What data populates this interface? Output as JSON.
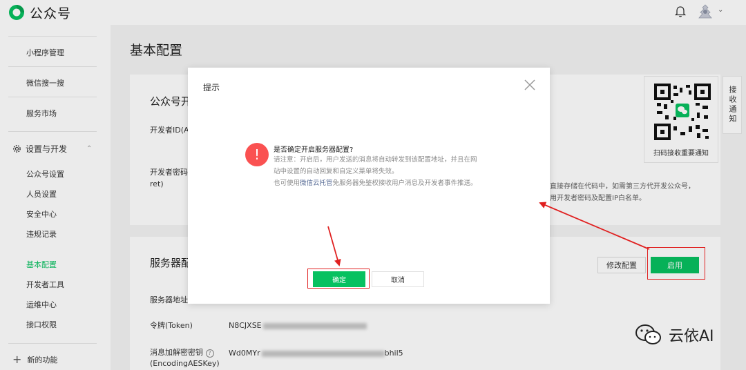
{
  "app": {
    "brand": "公众号"
  },
  "topbar": {
    "bell_icon": "bell-icon",
    "avatar_icon": "avatar-icon",
    "caret": "⌄"
  },
  "sidebar": {
    "items": [
      {
        "label": "小程序管理"
      },
      {
        "label": "微信搜一搜"
      },
      {
        "label": "服务市场"
      }
    ],
    "group": {
      "label": "设置与开发",
      "icon": "gear-icon",
      "chevron": "⌃"
    },
    "sub_items": [
      {
        "label": "公众号设置"
      },
      {
        "label": "人员设置"
      },
      {
        "label": "安全中心"
      },
      {
        "label": "违规记录"
      },
      {
        "label": "基本配置"
      },
      {
        "label": "开发者工具"
      },
      {
        "label": "运维中心"
      },
      {
        "label": "接口权限"
      }
    ],
    "active_index": 4,
    "new_function": {
      "plus": "+",
      "label": "新的功能"
    }
  },
  "main": {
    "title": "基本配置",
    "section1": {
      "title": "公众号开",
      "developer_id_label": "开发者ID(Ap",
      "secret_label_line1": "开发者密码(",
      "secret_label_line2": "ret)",
      "tip_line1": "直接存储在代码中，如需第三方代开发公众号，",
      "tip_line2": "用开发者密码及配置IP白名单。"
    },
    "section2": {
      "title": "服务器配",
      "server_url_label": "服务器地址(",
      "token_label": "令牌(Token)",
      "token_value": "N8CJXSE",
      "aes_label_line1": "消息加解密密钥",
      "aes_label_line2": "(EncodingAESKey)",
      "aes_help": "?",
      "aes_value_start": "Wd0MYr",
      "aes_value_end": "bhil5",
      "modify_button": "修改配置",
      "enable_button": "启用"
    },
    "qr": {
      "label": "扫码接收重要通知"
    },
    "receive_tab": "接收通知"
  },
  "dialog": {
    "title": "提示",
    "close_icon": "close-icon",
    "warning_icon": "exclamation-icon",
    "warning_glyph": "!",
    "question": "是否确定开启服务器配置?",
    "body_line1": "请注意：开启后，用户发送的消息将自动转发到该配置地址，并且在网",
    "body_line2": "站中设置的自动回复和自定义菜单将失效。",
    "body_line3_prefix": "也可使用",
    "body_line3_link": "微信云托管",
    "body_line3_suffix": "免服务器免鉴权接收用户消息及开发者事件推送。",
    "confirm_button": "确定",
    "cancel_button": "取消"
  },
  "annotation_color": "#e02020",
  "accent_color": "#07c160",
  "watermark": {
    "icon": "wechat-icon",
    "text": "云依AI"
  }
}
